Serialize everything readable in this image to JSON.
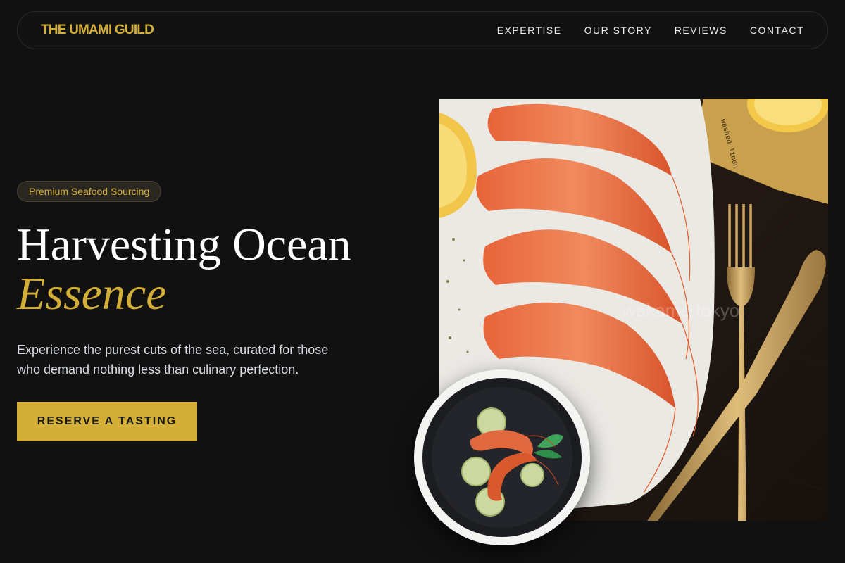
{
  "nav": {
    "brand": "THE UMAMI GUILD",
    "links": [
      "EXPERTISE",
      "OUR STORY",
      "REVIEWS",
      "CONTACT"
    ]
  },
  "hero": {
    "badge": "Premium Seafood Sourcing",
    "headline_line1": "Harvesting Ocean",
    "headline_line2": "Essence",
    "lead": "Experience the purest cuts of the sea, curated for those who demand nothing less than culinary perfection.",
    "cta": "RESERVE A TASTING"
  },
  "image": {
    "watermark": "wakame tokyo",
    "napkin_text": "washed linen"
  },
  "colors": {
    "background": "#111111",
    "accent": "#d4af37",
    "text": "#ffffff",
    "muted_text": "#d9dde3"
  }
}
